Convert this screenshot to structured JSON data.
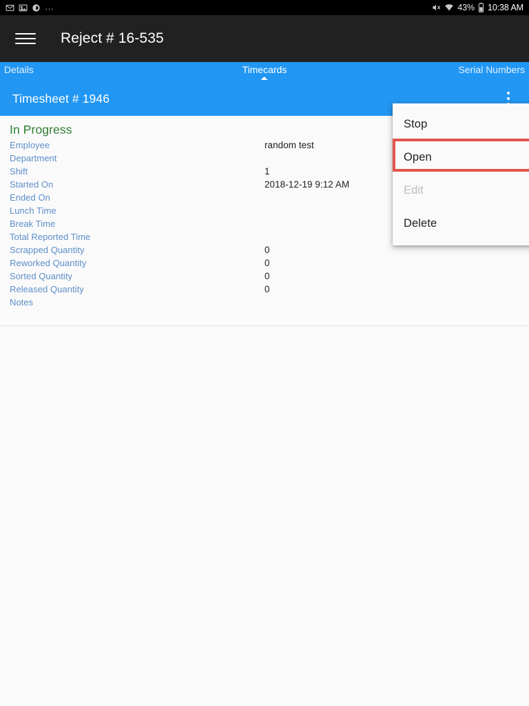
{
  "status_bar": {
    "left_icons": [
      {
        "name": "email-icon",
        "glyph": "envelope"
      },
      {
        "name": "image-icon",
        "glyph": "photo"
      },
      {
        "name": "app-notification-icon",
        "glyph": "circle"
      }
    ],
    "overflow_dots": "…",
    "mute_icon": "mute-icon",
    "wifi_icon": "wifi-icon",
    "battery_percent": "43%",
    "battery_icon": "battery-icon",
    "clock": "10:38 AM"
  },
  "app_bar": {
    "menu_icon": "hamburger-menu-icon",
    "title": "Reject # 16-535"
  },
  "tabs": [
    {
      "label": "Details",
      "active": false
    },
    {
      "label": "Timecards",
      "active": true
    },
    {
      "label": "Serial Numbers",
      "active": false
    }
  ],
  "sub_header": {
    "title": "Timesheet # 1946",
    "overflow_icon": "overflow-menu-icon"
  },
  "details": {
    "status": "In Progress",
    "rows": [
      {
        "label": "Employee",
        "value": "random test"
      },
      {
        "label": "Department",
        "value": ""
      },
      {
        "label": "Shift",
        "value": "1"
      },
      {
        "label": "Started On",
        "value": "2018-12-19 9:12 AM"
      },
      {
        "label": "Ended On",
        "value": ""
      },
      {
        "label": "Lunch Time",
        "value": ""
      },
      {
        "label": "Break Time",
        "value": ""
      },
      {
        "label": "Total Reported Time",
        "value": ""
      },
      {
        "label": "Scrapped Quantity",
        "value": "0"
      },
      {
        "label": "Reworked Quantity",
        "value": "0"
      },
      {
        "label": "Sorted Quantity",
        "value": "0"
      },
      {
        "label": "Released Quantity",
        "value": "0"
      },
      {
        "label": "Notes",
        "value": ""
      }
    ]
  },
  "popup_menu": {
    "items": [
      {
        "label": "Stop",
        "disabled": false,
        "highlighted": false
      },
      {
        "label": "Open",
        "disabled": false,
        "highlighted": true
      },
      {
        "label": "Edit",
        "disabled": true,
        "highlighted": false
      },
      {
        "label": "Delete",
        "disabled": false,
        "highlighted": false
      }
    ]
  },
  "colors": {
    "accent_blue": "#2196f3",
    "app_bar_dark": "#212121",
    "status_green": "#2e7d32",
    "label_blue": "#5d8ec9",
    "highlight_red": "#e2574c",
    "disabled_gray": "#bdbdbd"
  }
}
